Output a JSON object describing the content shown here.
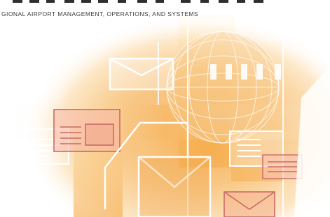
{
  "banner": {
    "tagline": "GIONAL AIRPORT MANAGEMENT, OPERATIONS, AND SYSTEMS"
  },
  "colors": {
    "background": "#ffffff",
    "orange_deep": "#f0a23a",
    "orange_light": "#ffe2b0",
    "rose": "#d98080",
    "text": "#3a3a3a"
  },
  "icons": [
    "envelope-icon",
    "document-icon",
    "globe-icon",
    "open-envelope-icon"
  ]
}
